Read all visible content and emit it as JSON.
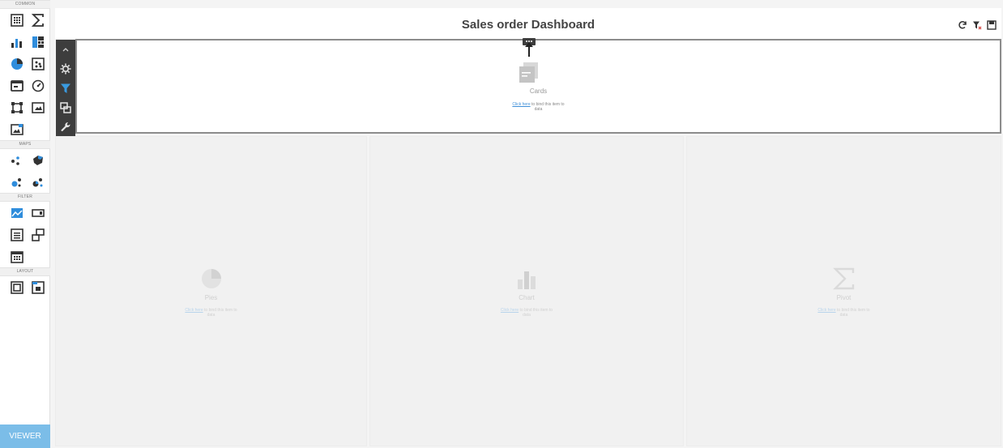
{
  "toolbox": {
    "sections": {
      "common": "COMMON",
      "maps": "MAPS",
      "filter": "FILTER",
      "layout": "LAYOUT"
    },
    "viewer_label": "VIEWER"
  },
  "header": {
    "title": "Sales order Dashboard"
  },
  "cards_widget": {
    "name": "Cards",
    "link_text": "Click here",
    "bind_text": " to bind this item to",
    "bind_text_2": "data"
  },
  "widgets": [
    {
      "name": "Pies",
      "link_text": "Click here",
      "bind_text": " to bind this item to",
      "bind_text_2": "data"
    },
    {
      "name": "Chart",
      "link_text": "Click here",
      "bind_text": " to bind this item to",
      "bind_text_2": "data"
    },
    {
      "name": "Pivot",
      "link_text": "Click here",
      "bind_text": " to bind this item to",
      "bind_text_2": "data"
    }
  ],
  "colors": {
    "accent": "#7bbde8",
    "filter_blue": "#3a9be0",
    "delete_red": "#c0392b",
    "toolbar_dark": "#3d3d3d"
  }
}
